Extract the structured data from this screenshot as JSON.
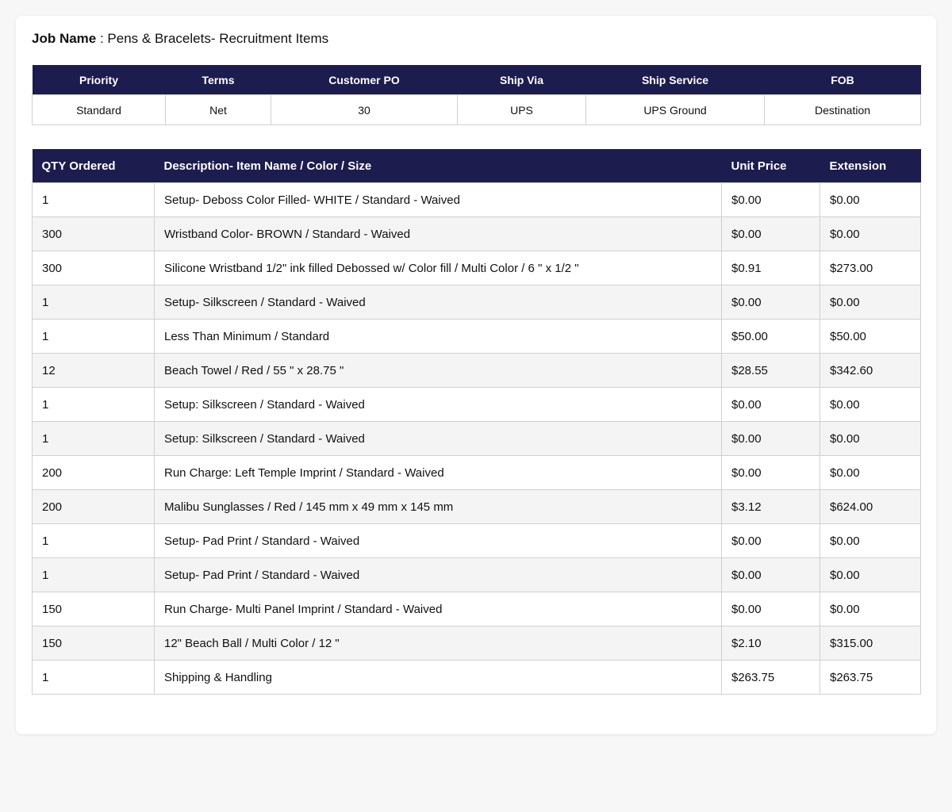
{
  "job": {
    "label": "Job Name",
    "separator": " : ",
    "value": "Pens & Bracelets- Recruitment Items"
  },
  "meta": {
    "headers": [
      "Priority",
      "Terms",
      "Customer PO",
      "Ship Via",
      "Ship Service",
      "FOB"
    ],
    "values": [
      "Standard",
      "Net",
      "30",
      "UPS",
      "UPS Ground",
      "Destination"
    ]
  },
  "items": {
    "headers": [
      "QTY Ordered",
      "Description- Item Name / Color / Size",
      "Unit Price",
      "Extension"
    ],
    "rows": [
      {
        "qty": "1",
        "desc": "Setup- Deboss Color Filled- WHITE / Standard - Waived",
        "unit": "$0.00",
        "ext": "$0.00"
      },
      {
        "qty": "300",
        "desc": "Wristband Color- BROWN / Standard - Waived",
        "unit": "$0.00",
        "ext": "$0.00"
      },
      {
        "qty": "300",
        "desc": "Silicone Wristband 1/2\" ink filled Debossed w/ Color fill / Multi Color / 6 \" x 1/2 \"",
        "unit": "$0.91",
        "ext": "$273.00"
      },
      {
        "qty": "1",
        "desc": "Setup- Silkscreen / Standard - Waived",
        "unit": "$0.00",
        "ext": "$0.00"
      },
      {
        "qty": "1",
        "desc": "Less Than Minimum / Standard",
        "unit": "$50.00",
        "ext": "$50.00"
      },
      {
        "qty": "12",
        "desc": "Beach Towel / Red / 55 \" x 28.75 \"",
        "unit": "$28.55",
        "ext": "$342.60"
      },
      {
        "qty": "1",
        "desc": "Setup: Silkscreen / Standard - Waived",
        "unit": "$0.00",
        "ext": "$0.00"
      },
      {
        "qty": "1",
        "desc": "Setup: Silkscreen / Standard - Waived",
        "unit": "$0.00",
        "ext": "$0.00"
      },
      {
        "qty": "200",
        "desc": "Run Charge: Left Temple Imprint / Standard - Waived",
        "unit": "$0.00",
        "ext": "$0.00"
      },
      {
        "qty": "200",
        "desc": "Malibu Sunglasses / Red / 145 mm x 49 mm x 145 mm",
        "unit": "$3.12",
        "ext": "$624.00"
      },
      {
        "qty": "1",
        "desc": "Setup- Pad Print / Standard - Waived",
        "unit": "$0.00",
        "ext": "$0.00"
      },
      {
        "qty": "1",
        "desc": "Setup- Pad Print / Standard - Waived",
        "unit": "$0.00",
        "ext": "$0.00"
      },
      {
        "qty": "150",
        "desc": "Run Charge- Multi Panel Imprint / Standard - Waived",
        "unit": "$0.00",
        "ext": "$0.00"
      },
      {
        "qty": "150",
        "desc": "12\" Beach Ball / Multi Color / 12 \"",
        "unit": "$2.10",
        "ext": "$315.00"
      },
      {
        "qty": "1",
        "desc": "Shipping & Handling",
        "unit": "$263.75",
        "ext": "$263.75"
      }
    ]
  },
  "colors": {
    "header_bg": "#1c1c4e",
    "stripe_bg": "#f4f4f4"
  }
}
